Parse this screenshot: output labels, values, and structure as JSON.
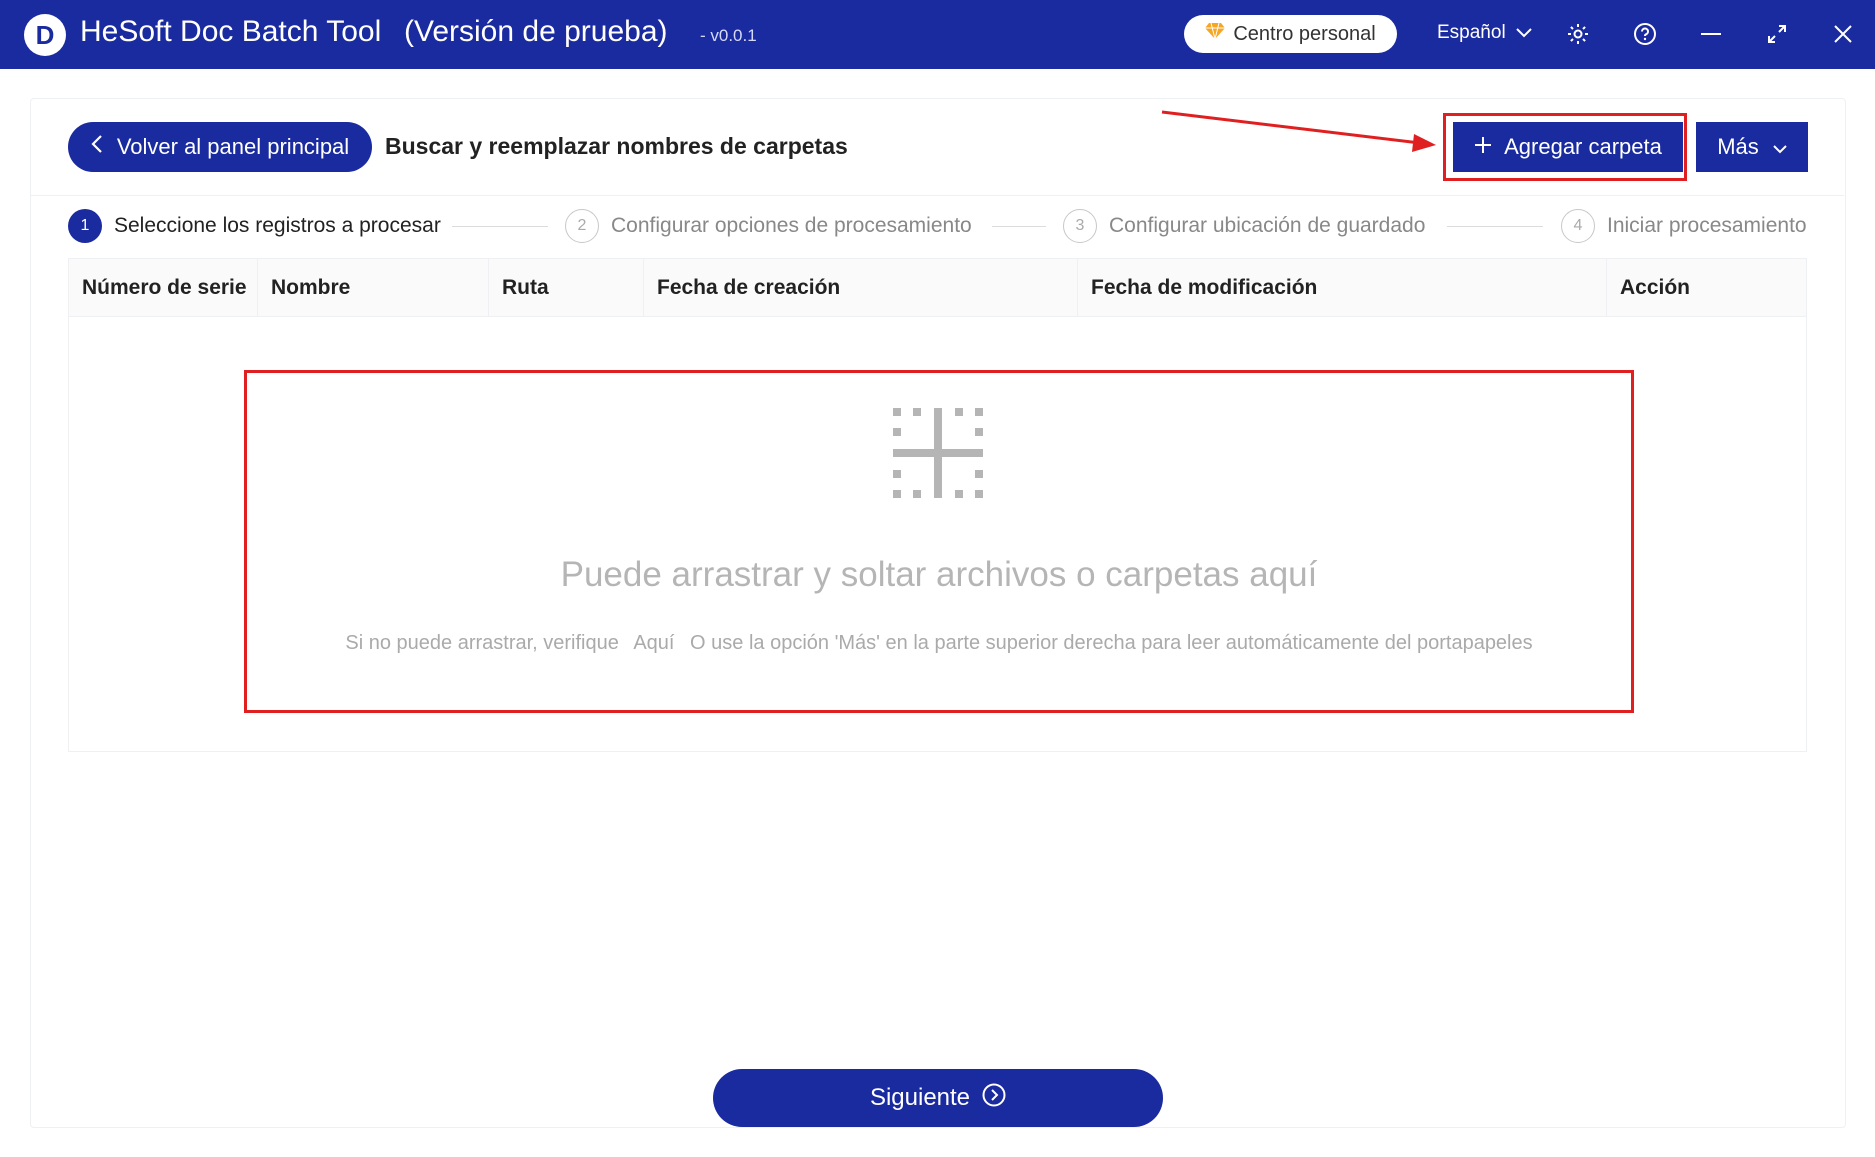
{
  "titlebar": {
    "logo_letter": "D",
    "app_name": "HeSoft Doc Batch Tool",
    "edition": "(Versión de prueba)",
    "version": "- v0.0.1",
    "personal_center": "Centro personal",
    "language": "Español",
    "icons": [
      "settings-icon",
      "help-icon",
      "minimize-icon",
      "maximize-icon",
      "close-icon"
    ]
  },
  "header": {
    "back_button": "Volver al panel principal",
    "page_title": "Buscar y reemplazar nombres de carpetas",
    "add_folder_button": "Agregar carpeta",
    "more_button": "Más"
  },
  "steps": [
    {
      "number": "1",
      "label": "Seleccione los registros a procesar",
      "active": true
    },
    {
      "number": "2",
      "label": "Configurar opciones de procesamiento",
      "active": false
    },
    {
      "number": "3",
      "label": "Configurar ubicación de guardado",
      "active": false
    },
    {
      "number": "4",
      "label": "Iniciar procesamiento",
      "active": false
    }
  ],
  "table": {
    "columns": [
      "Número de serie",
      "Nombre",
      "Ruta",
      "Fecha de creación",
      "Fecha de modificación",
      "Acción"
    ]
  },
  "dropzone": {
    "title": "Puede arrastrar y soltar archivos o carpetas aquí",
    "hint_prefix": "Si no puede arrastrar, verifique",
    "hint_link": "Aquí",
    "hint_suffix": "O use la opción 'Más' en la parte superior derecha para leer automáticamente del portapapeles"
  },
  "footer": {
    "next_button": "Siguiente"
  },
  "colors": {
    "primary": "#1a2a9f",
    "annotation_red": "#e02020",
    "personal_badge": "#f5a623"
  }
}
